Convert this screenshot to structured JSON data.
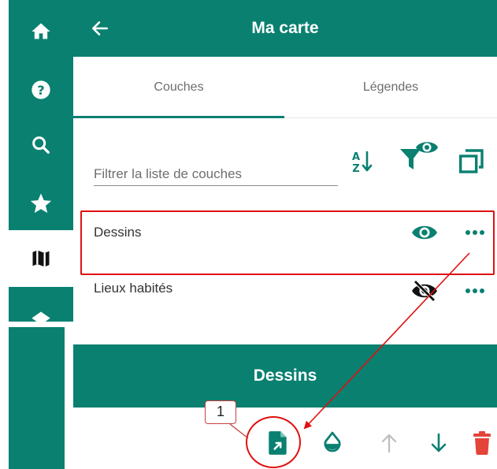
{
  "header": {
    "title": "Ma carte"
  },
  "sidebar": {
    "items": [
      {
        "icon": "home-icon"
      },
      {
        "icon": "help-icon"
      },
      {
        "icon": "search-icon"
      },
      {
        "icon": "star-icon"
      },
      {
        "icon": "map-icon",
        "active": true
      },
      {
        "icon": "layers-icon"
      }
    ]
  },
  "tabs": [
    {
      "label": "Couches",
      "active": true
    },
    {
      "label": "Légendes"
    }
  ],
  "filter": {
    "placeholder": "Filtrer la liste de couches"
  },
  "toolbar": {
    "icons": [
      "sort-az-icon",
      "filter-visible-icon",
      "select-all-icon"
    ]
  },
  "layers": [
    {
      "name": "Dessins",
      "visible": true
    },
    {
      "name": "Lieux habités",
      "visible": false
    }
  ],
  "detail": {
    "title": "Dessins",
    "actions": [
      "export-file-icon",
      "style-drop-icon",
      "arrow-up-icon",
      "arrow-down-icon",
      "delete-icon"
    ]
  },
  "annotation": {
    "callout_number": "1"
  },
  "colors": {
    "primary": "#0a8071",
    "highlight": "#e01010",
    "delete": "#e4443a"
  }
}
